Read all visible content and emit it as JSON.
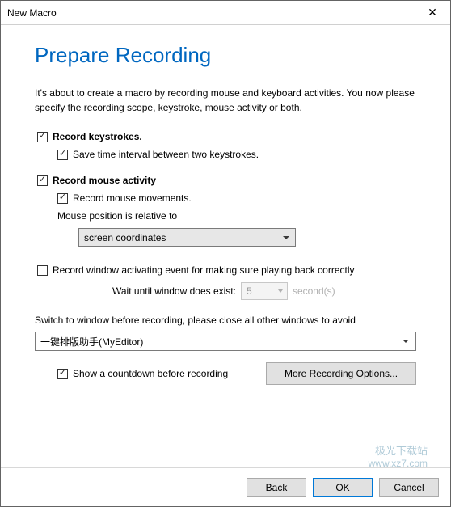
{
  "window": {
    "title": "New Macro",
    "close_icon": "✕"
  },
  "heading": "Prepare Recording",
  "intro": "It's about to create a macro by recording mouse and keyboard activities. You now please specify the recording scope, keystroke, mouse activity or both.",
  "record_keystrokes": {
    "checked": true,
    "label": "Record keystrokes.",
    "save_interval": {
      "checked": true,
      "label": "Save time interval between two keystrokes."
    }
  },
  "record_mouse": {
    "checked": true,
    "label": "Record mouse activity",
    "movements": {
      "checked": true,
      "label": "Record mouse movements."
    },
    "position_label": "Mouse position is relative to",
    "position_value": "screen coordinates"
  },
  "record_window_event": {
    "checked": false,
    "label": "Record window activating event for making sure playing back correctly",
    "wait_label": "Wait until window does exist:",
    "wait_value": "5",
    "wait_unit": "second(s)"
  },
  "switch_window": {
    "label": "Switch to window before recording, please close all other windows to avoid",
    "value": "一键排版助手(MyEditor)"
  },
  "countdown": {
    "checked": true,
    "label": "Show a countdown before recording"
  },
  "buttons": {
    "more": "More Recording Options...",
    "back": "Back",
    "ok": "OK",
    "cancel": "Cancel"
  },
  "watermark": {
    "line1": "极光下载站",
    "line2": "www.xz7.com"
  }
}
